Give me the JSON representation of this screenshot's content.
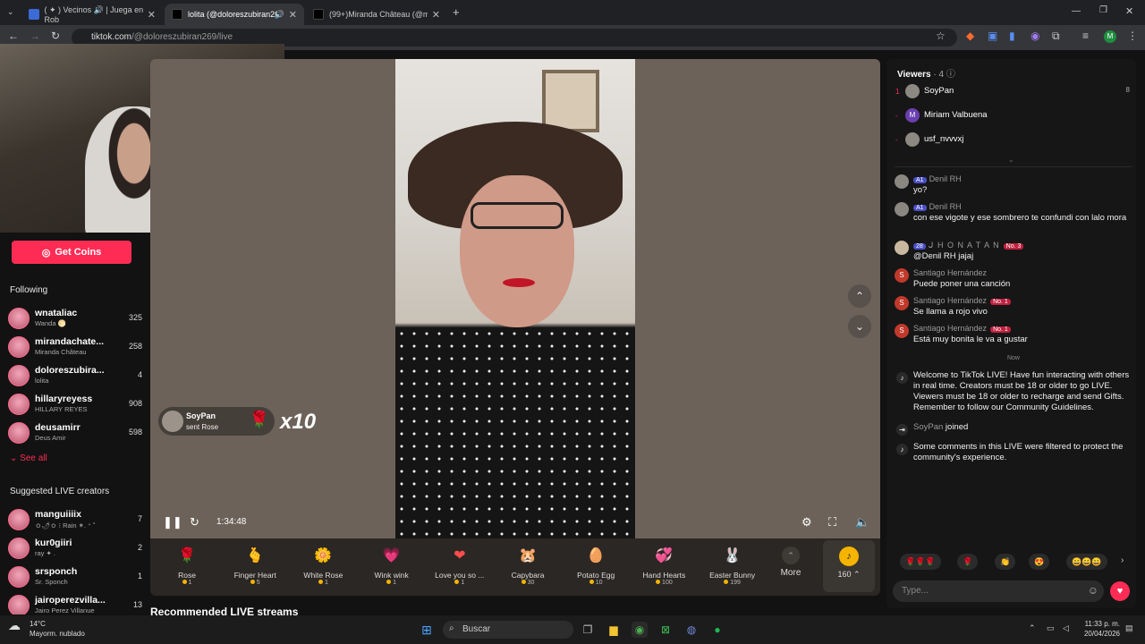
{
  "browser": {
    "tabs": [
      {
        "title": "( ✦ ) Vecinos 🔊 | Juega en Rob",
        "active": false
      },
      {
        "title": "lolita (@doloreszubiran269)",
        "active": true
      },
      {
        "title": "(99+)Miranda Château (@mira",
        "active": false
      }
    ],
    "url_domain": "tiktok.com",
    "url_path": "/@doloreszubiran269/live",
    "new_tab": "+"
  },
  "sidebar": {
    "get_coins": "Get Coins",
    "following_title": "Following",
    "following": [
      {
        "name": "wnataliac",
        "sub": "Wanda 🌕",
        "count": "325"
      },
      {
        "name": "mirandachate...",
        "sub": "Miranda Château",
        "count": "258"
      },
      {
        "name": "doloreszubira...",
        "sub": "lolita",
        "count": "4"
      },
      {
        "name": "hillaryreyess",
        "sub": "HILLARY REYES",
        "count": "908"
      },
      {
        "name": "deusamirr",
        "sub": "Deus Amir",
        "count": "598"
      }
    ],
    "see_all": "See all",
    "suggested_title": "Suggested LIVE creators",
    "suggested": [
      {
        "name": "manguiiiix",
        "sub": "ｏ🌶ｏ ⁝ Rain ✶. ⁺ ˚",
        "count": "7"
      },
      {
        "name": "kur0giiri",
        "sub": "ray ✦ .",
        "count": "2"
      },
      {
        "name": "srsponch",
        "sub": "Sr. Sponch",
        "count": "1"
      },
      {
        "name": "jairoperezvilla...",
        "sub": "Jairo Perez Villanue",
        "count": "13"
      }
    ]
  },
  "player": {
    "gift_notice": {
      "user": "SoyPan",
      "action": "sent Rose",
      "combo": "x10"
    },
    "timer": "1:34:48"
  },
  "gifts": [
    {
      "name": "Rose",
      "price": "1",
      "icon": "🌹",
      "color": "#e2264b"
    },
    {
      "name": "Finger Heart",
      "price": "5",
      "icon": "🫰",
      "color": "#f08a5d"
    },
    {
      "name": "White Rose",
      "price": "1",
      "icon": "🌼",
      "color": "#f1f1f1"
    },
    {
      "name": "Wink wink",
      "price": "1",
      "icon": "💗",
      "color": "#ff6fb5"
    },
    {
      "name": "Love you so ...",
      "price": "1",
      "icon": "❤",
      "color": "#ff4d4d"
    },
    {
      "name": "Capybara",
      "price": "30",
      "icon": "🐹",
      "color": "#b9875a"
    },
    {
      "name": "Potato Egg",
      "price": "10",
      "icon": "🥚",
      "color": "#e8c9a0"
    },
    {
      "name": "Hand Hearts",
      "price": "100",
      "icon": "💞",
      "color": "#f58ecb"
    },
    {
      "name": "Easter Bunny",
      "price": "199",
      "icon": "🐰",
      "color": "#c9a6f0"
    }
  ],
  "more_label": "More",
  "coins_label": "160",
  "recommended": "Recommended LIVE streams",
  "viewers": {
    "title": "Viewers",
    "count": "· 4",
    "list": [
      {
        "rank": "1",
        "name": "SoyPan",
        "count": "8"
      },
      {
        "rank": "-",
        "name": "Miriam Valbuena",
        "count": ""
      },
      {
        "rank": "-",
        "name": "usf_nvvvxj",
        "count": ""
      }
    ]
  },
  "comments": [
    {
      "user": "Denil RH",
      "badge": "A1",
      "no1": "",
      "text": "yo?",
      "avatar": ""
    },
    {
      "user": "Denil RH",
      "badge": "A1",
      "no1": "",
      "text": "con ese vigote y ese sombrero te confundi con lalo mora",
      "avatar": ""
    },
    {
      "user": "ᒍ H O N A T A N",
      "badge": "28",
      "no1": "No. 3",
      "text": "@Denil RH jajaj",
      "avatar": ""
    },
    {
      "user": "Santiago Hernández",
      "badge": "",
      "no1": "",
      "text": "Puede poner una canción",
      "avatar": "S"
    },
    {
      "user": "Santiago Hernández",
      "badge": "",
      "no1": "No. 1",
      "text": "Se llama a rojo vivo",
      "avatar": "S"
    },
    {
      "user": "Santiago Hernández",
      "badge": "",
      "no1": "No. 1",
      "text": "Está muy bonita le va a gustar",
      "avatar": "S"
    }
  ],
  "now_label": "Now",
  "system": {
    "welcome": "Welcome to TikTok LIVE! Have fun interacting with others in real time. Creators must be 18 or older to go LIVE. Viewers must be 18 or older to recharge and send Gifts. Remember to follow our Community Guidelines.",
    "joined_user": "SoyPan",
    "joined_text": "joined",
    "filtered": "Some comments in this LIVE were filtered to protect the community's experience."
  },
  "chat_input_placeholder": "Type...",
  "taskbar": {
    "temp": "14°C",
    "weather": "Mayorm. nublado",
    "search": "Buscar",
    "time": "11:33 p. m.",
    "date": "20/04/2026"
  }
}
